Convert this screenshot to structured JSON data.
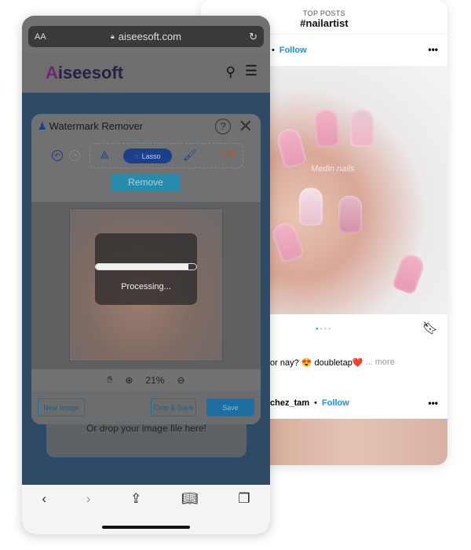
{
  "instagram": {
    "subtitle": "TOP POSTS",
    "hashtag": "#nailartist",
    "follow1": "Follow",
    "more_icon": "more-horizontal-icon",
    "caption": "or nay? 😍  doubletap❤️",
    "caption_more": "... more",
    "user2": "chez_tam",
    "follow2": "Follow",
    "watermark": "Medin nails"
  },
  "browser": {
    "aa": "AA",
    "url": "aiseesoft.com"
  },
  "site": {
    "logo_a": "A",
    "logo_rest": "iseesoft"
  },
  "dialog": {
    "title": "Watermark Remover",
    "help": "?",
    "lasso": "Lasso",
    "remove": "Remove",
    "processing": "Processing...",
    "progress": 0.92,
    "zoom": "21%",
    "new_image": "New Image",
    "crop_save": "Crop & Save",
    "save": "Save"
  },
  "drop_text": "Or drop your image file here!",
  "colors": {
    "accent": "#1a90e0",
    "dialog_primary": "#1b3f8a"
  }
}
